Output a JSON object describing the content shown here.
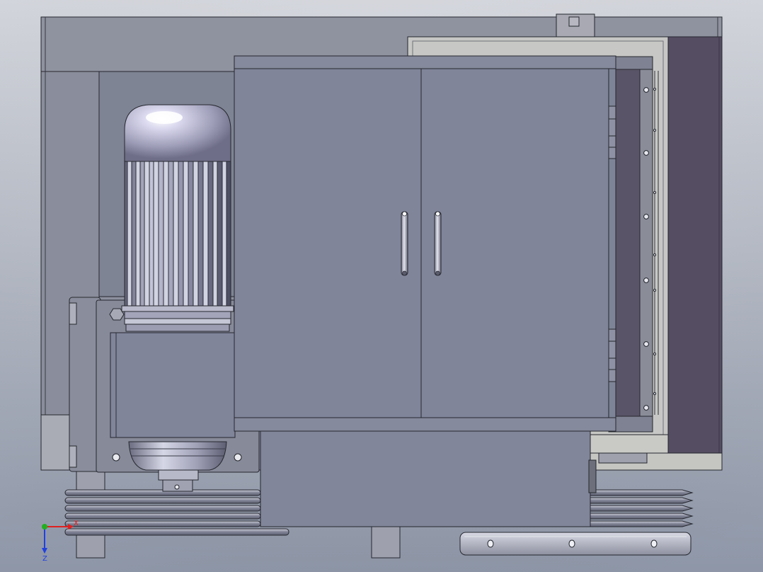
{
  "viewport": {
    "background_top": "#dfe3ea",
    "background_bottom": "#9aa3b4"
  },
  "palette": {
    "frame_light": "#8f929f",
    "frame_mid": "#7d808f",
    "panel_blue_grey": "#7e8395",
    "panel_edge": "#2a2c34",
    "frame_cream": "#c8c9c6",
    "dark_purple": "#554d62",
    "motor_shell": "#9fa0b8",
    "motor_highlight": "#ffffff",
    "bolt_fill": "#e8e9ee",
    "belt_fill": "#8c8f9e"
  },
  "model_parts": [
    "outer-frame",
    "top-rail",
    "motor-recess",
    "electric-motor",
    "motor-mount-plate",
    "gear-housing",
    "electrical-cabinet",
    "cabinet-door-left",
    "cabinet-door-right",
    "door-handle-left",
    "door-handle-right",
    "door-hinges",
    "right-side-guard",
    "side-cover-panel",
    "lower-housing",
    "belt-pulley-left",
    "belt-pulley-right",
    "base-rail",
    "support-feet",
    "exhaust-port"
  ],
  "triad": {
    "x_label": "X",
    "z_label": "Z",
    "x_color": "#e02020",
    "y_color": "#20b020",
    "z_color": "#2040e0"
  }
}
